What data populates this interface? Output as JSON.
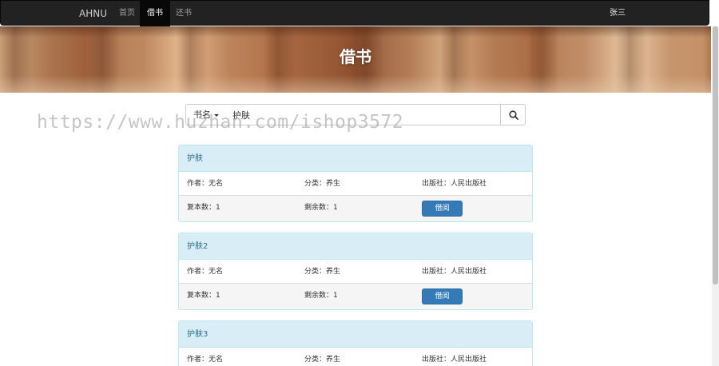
{
  "navbar": {
    "brand": "AHNU",
    "items": [
      {
        "label": "首页"
      },
      {
        "label": "借书"
      },
      {
        "label": "还书"
      }
    ],
    "user": "张三"
  },
  "banner": {
    "title": "借书"
  },
  "search": {
    "dropdown_label": "书名",
    "value": "护肤"
  },
  "watermark": "https://www.huzhan.com/ishop3572",
  "books": [
    {
      "title": "护肤",
      "author": "作者：无名",
      "category": "分类：养生",
      "publisher": "出版社：人民出版社",
      "copies": "复本数：1",
      "remaining": "剩余数：1",
      "button": "借阅"
    },
    {
      "title": "护肤2",
      "author": "作者：无名",
      "category": "分类：养生",
      "publisher": "出版社：人民出版社",
      "copies": "复本数：1",
      "remaining": "剩余数：1",
      "button": "借阅"
    },
    {
      "title": "护肤3",
      "author": "作者：无名",
      "category": "分类：养生",
      "publisher": "出版社：人民出版社"
    }
  ],
  "colors": {
    "navbar_bg": "#222222",
    "panel_head_bg": "#d9edf7",
    "panel_border": "#bce8f1",
    "button_primary": "#337ab7"
  }
}
